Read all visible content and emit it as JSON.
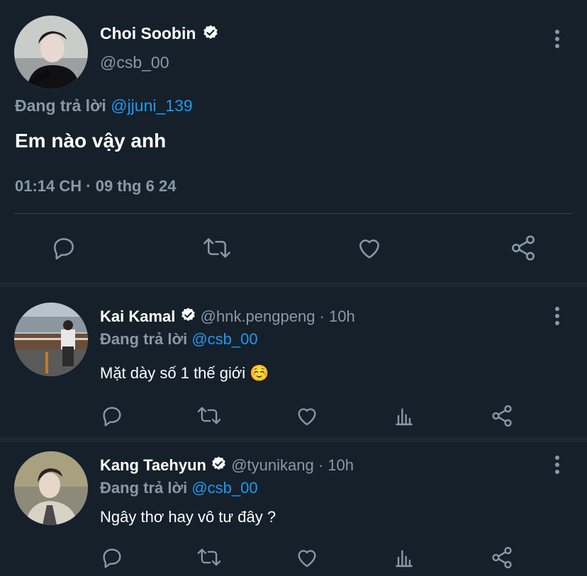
{
  "main_tweet": {
    "display_name": "Choi Soobin",
    "handle": "@csb_00",
    "replying_label": "Đang trả lời",
    "replying_to": "@jjuni_139",
    "text": "Em nào vậy anh",
    "timestamp": "01:14 CH · 09 thg 6 24",
    "actions": [
      "reply-icon",
      "retweet-icon",
      "like-icon",
      "share-icon"
    ]
  },
  "replies": [
    {
      "display_name": "Kai Kamal",
      "meta": "@hnk.pengpeng · 10h",
      "replying_label": "Đang trả lời",
      "replying_to": "@csb_00",
      "text": "Mặt dày số 1 thế giới ☺️"
    },
    {
      "display_name": "Kang Taehyun",
      "meta": "@tyunikang · 10h",
      "replying_label": "Đang trả lời",
      "replying_to": "@csb_00",
      "text": "Ngây thơ hay vô tư đây ?"
    }
  ],
  "colors": {
    "background": "#15202b",
    "muted": "#8899a6",
    "link": "#1d9bf0",
    "separator": "#1e2732"
  }
}
